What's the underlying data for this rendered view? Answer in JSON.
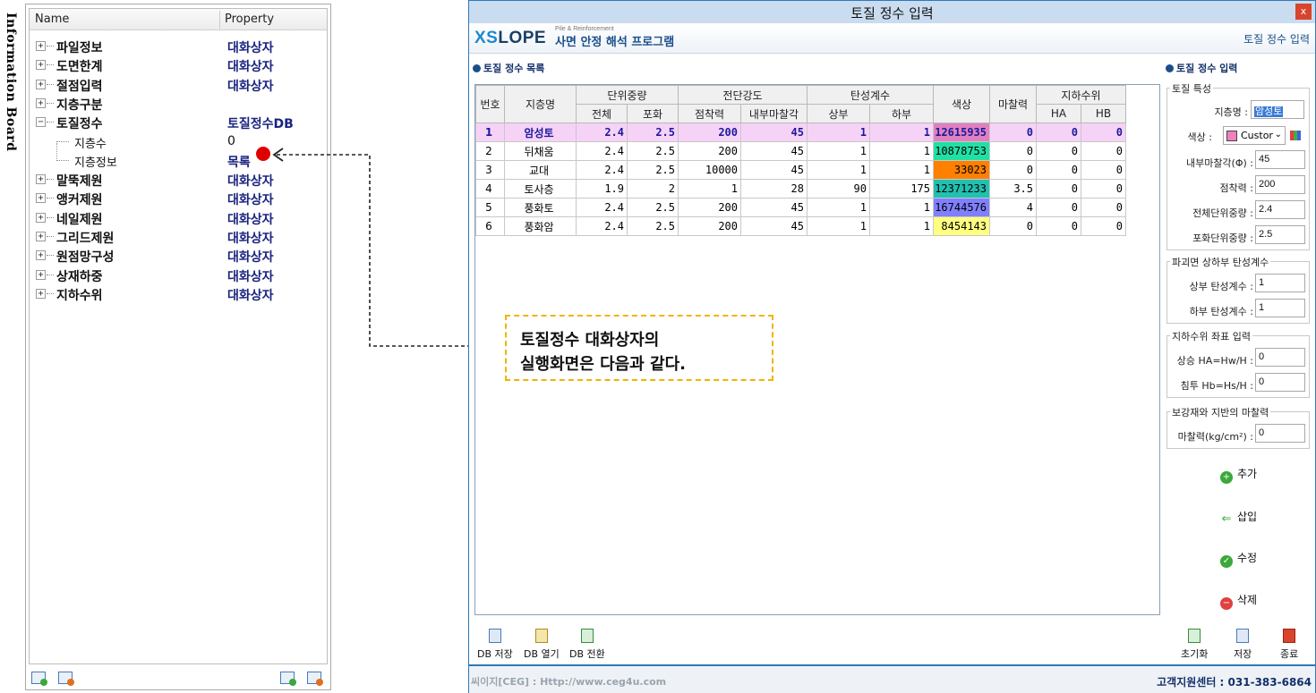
{
  "info_board": {
    "tab_label": "Information Board",
    "col_name": "Name",
    "col_property": "Property",
    "items": [
      {
        "expand": "+",
        "name": "파일정보",
        "property": "대화상자"
      },
      {
        "expand": "+",
        "name": "도면한계",
        "property": "대화상자"
      },
      {
        "expand": "+",
        "name": "절점입력",
        "property": "대화상자"
      },
      {
        "expand": "+",
        "name": "지층구분",
        "property": ""
      },
      {
        "expand": "−",
        "name": "토질정수",
        "property": "토질정수DB"
      },
      {
        "expand": "",
        "name": "지층수",
        "property": "0"
      },
      {
        "expand": "",
        "name": "지층정보",
        "property": "목록"
      },
      {
        "expand": "+",
        "name": "말뚝제원",
        "property": "대화상자"
      },
      {
        "expand": "+",
        "name": "앵커제원",
        "property": "대화상자"
      },
      {
        "expand": "+",
        "name": "네일제원",
        "property": "대화상자"
      },
      {
        "expand": "+",
        "name": "그리드제원",
        "property": "대화상자"
      },
      {
        "expand": "+",
        "name": "원점망구성",
        "property": "대화상자"
      },
      {
        "expand": "+",
        "name": "상재하중",
        "property": "대화상자"
      },
      {
        "expand": "+",
        "name": "지하수위",
        "property": "대화상자"
      }
    ]
  },
  "window": {
    "title": "토질 정수 입력",
    "close": "x",
    "logo_xs": "XS",
    "logo_lope": "LOPE",
    "logo_pile": "Pile & Reinforcement",
    "slogan": "사면 안정 해석 프로그램",
    "brand_right": "토질 정수 입력"
  },
  "soil_list": {
    "section_title": "토질 정수 목록",
    "headers": {
      "no": "번호",
      "layer": "지층명",
      "unit_weight": "단위중량",
      "total": "전체",
      "saturated": "포화",
      "shear": "전단강도",
      "cohesion": "점착력",
      "friction": "내부마찰각",
      "elastic": "탄성계수",
      "upper": "상부",
      "lower": "하부",
      "color": "색상",
      "wall_friction": "마찰력",
      "gw": "지하수위",
      "ha": "HA",
      "hb": "HB"
    },
    "rows": [
      {
        "no": "1",
        "name": "암성토",
        "total": "2.4",
        "sat": "2.5",
        "coh": "200",
        "phi": "45",
        "up": "1",
        "low": "1",
        "color": "12615935",
        "fric": "0",
        "ha": "0",
        "hb": "0",
        "bg": "#e080c0",
        "selected": true
      },
      {
        "no": "2",
        "name": "뒤채움",
        "total": "2.4",
        "sat": "2.5",
        "coh": "200",
        "phi": "45",
        "up": "1",
        "low": "1",
        "color": "10878753",
        "fric": "0",
        "ha": "0",
        "hb": "0",
        "bg": "#21e0a5",
        "selected": false
      },
      {
        "no": "3",
        "name": "교대",
        "total": "2.4",
        "sat": "2.5",
        "coh": "10000",
        "phi": "45",
        "up": "1",
        "low": "1",
        "color": "33023",
        "fric": "0",
        "ha": "0",
        "hb": "0",
        "bg": "#ff8000",
        "selected": false
      },
      {
        "no": "4",
        "name": "토사층",
        "total": "1.9",
        "sat": "2",
        "coh": "1",
        "phi": "28",
        "up": "90",
        "low": "175",
        "color": "12371233",
        "fric": "3.5",
        "ha": "0",
        "hb": "0",
        "bg": "#21c0b0",
        "selected": false
      },
      {
        "no": "5",
        "name": "풍화토",
        "total": "2.4",
        "sat": "2.5",
        "coh": "200",
        "phi": "45",
        "up": "1",
        "low": "1",
        "color": "16744576",
        "fric": "4",
        "ha": "0",
        "hb": "0",
        "bg": "#8080ff",
        "selected": false
      },
      {
        "no": "6",
        "name": "풍화암",
        "total": "2.4",
        "sat": "2.5",
        "coh": "200",
        "phi": "45",
        "up": "1",
        "low": "1",
        "color": "8454143",
        "fric": "0",
        "ha": "0",
        "hb": "0",
        "bg": "#ffff80",
        "selected": false
      }
    ]
  },
  "soil_input": {
    "section_title": "토질 정수 입력",
    "group1": "토질 특성",
    "layer_label": "지층명 :",
    "layer_value": "암성토",
    "color_label": "색상 :",
    "color_value": "Custor",
    "friction_label": "내부마찰각(Φ) :",
    "friction_value": "45",
    "cohesion_label": "점착력 :",
    "cohesion_value": "200",
    "total_label": "전체단위중량 :",
    "total_value": "2.4",
    "sat_label": "포화단위중량 :",
    "sat_value": "2.5",
    "group2": "파괴면 상하부 탄성계수",
    "upper_label": "상부 탄성계수 :",
    "upper_value": "1",
    "lower_label": "하부 탄성계수 :",
    "lower_value": "1",
    "group3": "지하수위 좌표 입력",
    "ha_label": "상승 HA=Hw/H :",
    "ha_value": "0",
    "hb_label": "침투 Hb=Hs/H :",
    "hb_value": "0",
    "group4": "보강재와 지반의 마찰력",
    "fric_label": "마찰력(kg/cm²) :",
    "fric_value": "0",
    "btn_add": "추가",
    "btn_insert": "삽입",
    "btn_edit": "수정",
    "btn_delete": "삭제"
  },
  "toolbar": {
    "db_save": "DB 저장",
    "db_open": "DB 열기",
    "db_convert": "DB 전환",
    "reset": "초기화",
    "save": "저장",
    "exit": "종료"
  },
  "status": {
    "left": "씨이지[CEG] : Http://www.ceg4u.com",
    "right": "고객지원센터 : 031-383-6864"
  },
  "callout": {
    "line1": "토질정수 대화상자의",
    "line2": "실행화면은 다음과 같다."
  }
}
